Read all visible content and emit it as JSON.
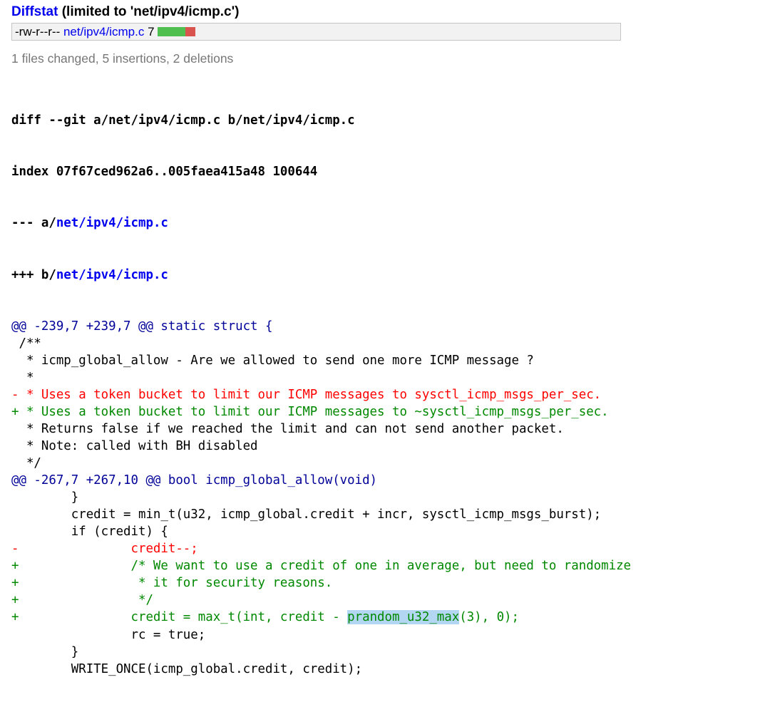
{
  "diffstat": {
    "link_label": "Diffstat",
    "limit_note": "(limited to 'net/ipv4/icmp.c')",
    "file_mode": "-rw-r--r--",
    "file_path": "net/ipv4/icmp.c",
    "change_count": "7",
    "insert_color": "#4fc04f",
    "delete_color": "#d9534f",
    "summary": "1 files changed, 5 insertions, 2 deletions"
  },
  "diff": {
    "git_line": "diff --git a/net/ipv4/icmp.c b/net/ipv4/icmp.c",
    "index_line": "index 07f67ced962a6..005faea415a48 100644",
    "old_prefix": "--- a/",
    "old_path": "net/ipv4/icmp.c",
    "new_prefix": "+++ b/",
    "new_path": "net/ipv4/icmp.c",
    "lines": [
      {
        "type": "hunk",
        "text": "@@ -239,7 +239,7 @@ static struct {"
      },
      {
        "type": "ctx",
        "text": " /**"
      },
      {
        "type": "ctx",
        "text": "  * icmp_global_allow - Are we allowed to send one more ICMP message ?"
      },
      {
        "type": "ctx",
        "text": "  *"
      },
      {
        "type": "del",
        "text": "- * Uses a token bucket to limit our ICMP messages to sysctl_icmp_msgs_per_sec."
      },
      {
        "type": "add",
        "text": "+ * Uses a token bucket to limit our ICMP messages to ~sysctl_icmp_msgs_per_sec."
      },
      {
        "type": "ctx",
        "text": "  * Returns false if we reached the limit and can not send another packet."
      },
      {
        "type": "ctx",
        "text": "  * Note: called with BH disabled"
      },
      {
        "type": "ctx",
        "text": "  */"
      },
      {
        "type": "hunk",
        "text": "@@ -267,7 +267,10 @@ bool icmp_global_allow(void)"
      },
      {
        "type": "ctx",
        "text": "        }"
      },
      {
        "type": "ctx",
        "text": "        credit = min_t(u32, icmp_global.credit + incr, sysctl_icmp_msgs_burst);"
      },
      {
        "type": "ctx",
        "text": "        if (credit) {"
      },
      {
        "type": "del",
        "text": "-               credit--;"
      },
      {
        "type": "add",
        "text": "+               /* We want to use a credit of one in average, but need to randomize"
      },
      {
        "type": "add",
        "text": "+                * it for security reasons."
      },
      {
        "type": "add",
        "text": "+                */"
      },
      {
        "type": "add",
        "text": "+               credit = max_t(int, credit - prandom_u32_max(3), 0);",
        "highlight": "prandom_u32_max"
      },
      {
        "type": "ctx",
        "text": "                rc = true;"
      },
      {
        "type": "ctx",
        "text": "        }"
      },
      {
        "type": "ctx",
        "text": "        WRITE_ONCE(icmp_global.credit, credit);"
      }
    ]
  }
}
